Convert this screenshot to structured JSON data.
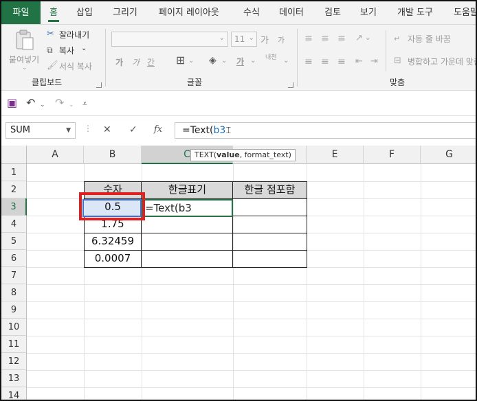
{
  "ribbon_tabs": {
    "file": "파일",
    "home": "홈",
    "insert": "삽입",
    "draw": "그리기",
    "page_layout": "페이지 레이아웃",
    "formulas": "수식",
    "data": "데이터",
    "review": "검토",
    "view": "보기",
    "developer": "개발 도구",
    "help": "도움말"
  },
  "clipboard": {
    "paste": "붙여넣기",
    "cut": "잘라내기",
    "copy": "복사",
    "format_painter": "서식 복사",
    "group_label": "클립보드"
  },
  "font": {
    "font_name": "",
    "font_size": "11",
    "grow": "가",
    "shrink": "가",
    "bold": "가",
    "italic": "가",
    "underline": "간",
    "phonetic": "내천",
    "group_label": "글꼴"
  },
  "alignment": {
    "wrap_text": "자동 줄 바꿈",
    "merge_center": "병합하고 가운데 맞춤",
    "group_label": "맞춤"
  },
  "formula_bar": {
    "name_box": "SUM",
    "fx": "fx",
    "formula_prefix": "=Text(",
    "formula_ref": "b3",
    "tooltip_fn": "TEXT(",
    "tooltip_arg1": "value",
    "tooltip_rest": ", format_text)"
  },
  "columns": [
    "A",
    "B",
    "C",
    "D",
    "E",
    "F",
    "G"
  ],
  "rows": [
    "1",
    "2",
    "3",
    "4",
    "5",
    "6",
    "7",
    "8",
    "9",
    "10",
    "11",
    "12",
    "13",
    "14"
  ],
  "table": {
    "headers": [
      "숫자",
      "한글표기",
      "한글 점포함"
    ],
    "numbers": [
      "0.5",
      "1.75",
      "6.32459",
      "0.0007"
    ],
    "editing_cell": "=Text(b3"
  },
  "colors": {
    "accent": "#217346",
    "selection_border": "#4472c4",
    "highlight_box": "#e02020",
    "header_fill": "#d9d9d9",
    "formula_ref": "#1f6fb2"
  }
}
